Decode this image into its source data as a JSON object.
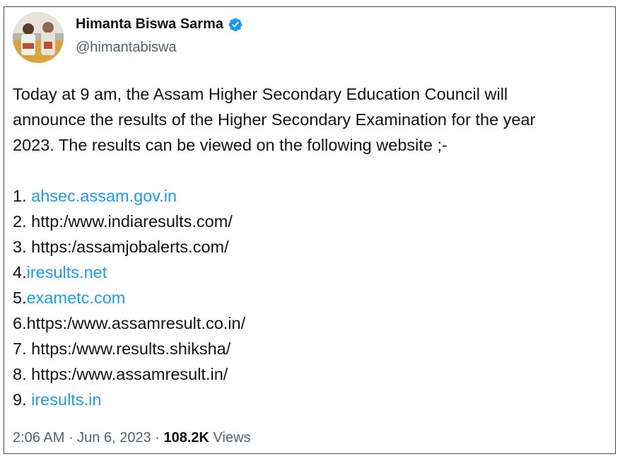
{
  "author": {
    "name": "Himanta Biswa Sarma",
    "handle": "@himantabiswa",
    "verified_color": "#1d9bf0"
  },
  "tweet": {
    "intro_line1": "Today at 9 am, the Assam Higher Secondary Education Council will",
    "intro_line2": "announce the results of the Higher Secondary Examination for the year",
    "intro_line3": "2023. The results can be viewed on the following website ;-",
    "items": [
      {
        "prefix": "1. ",
        "text": "ahsec.assam.gov.in",
        "link": true
      },
      {
        "prefix": "",
        "text": "2. http:/www.indiaresults.com/",
        "link": false
      },
      {
        "prefix": "",
        "text": "3. https:/assamjobalerts.com/",
        "link": false
      },
      {
        "prefix": "4.",
        "text": "iresults.net",
        "link": true
      },
      {
        "prefix": "5.",
        "text": "exametc.com",
        "link": true
      },
      {
        "prefix": "",
        "text": "6.https:/www.assamresult.co.in/",
        "link": false
      },
      {
        "prefix": "",
        "text": "7. https:/www.results.shiksha/",
        "link": false
      },
      {
        "prefix": "",
        "text": "8. https:/www.assamresult.in/",
        "link": false
      },
      {
        "prefix": "9. ",
        "text": "iresults.in",
        "link": true
      }
    ]
  },
  "meta": {
    "time": "2:06 AM",
    "sep": " · ",
    "date": "Jun 6, 2023",
    "views_count": "108.2K",
    "views_label": " Views"
  }
}
